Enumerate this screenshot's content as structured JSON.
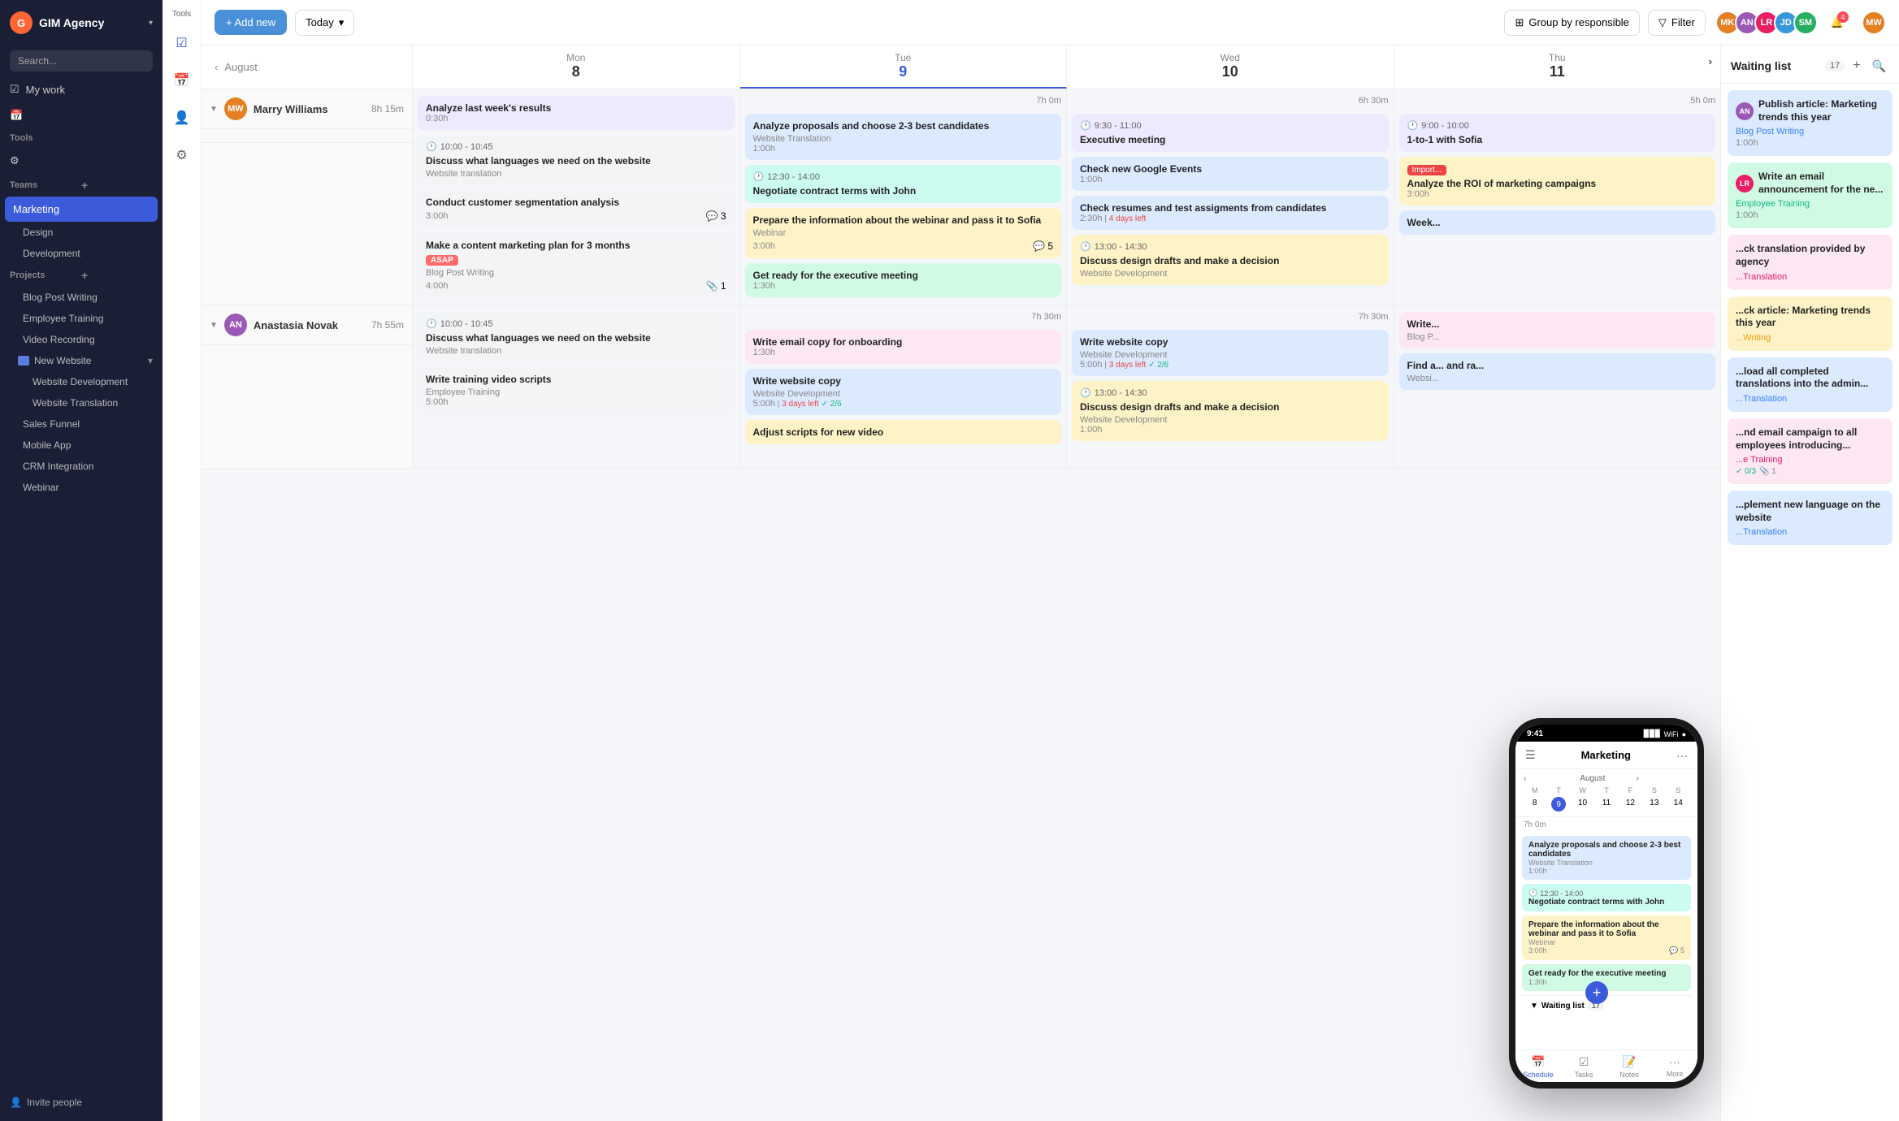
{
  "app": {
    "logo_label": "G",
    "company_name": "GIM Agency",
    "chevron": "▾"
  },
  "sidebar": {
    "search_placeholder": "Search...",
    "nav_items": [
      {
        "id": "my-work",
        "label": "My work",
        "icon": "☑"
      },
      {
        "id": "calendar",
        "label": "",
        "icon": "📅"
      },
      {
        "id": "people",
        "label": "",
        "icon": "👤"
      },
      {
        "id": "settings",
        "label": "",
        "icon": "⚙"
      }
    ],
    "tools_label": "Tools",
    "teams_label": "Teams",
    "teams": [
      {
        "id": "marketing",
        "label": "Marketing",
        "active": true
      },
      {
        "id": "design",
        "label": "Design"
      },
      {
        "id": "development",
        "label": "Development"
      }
    ],
    "projects_label": "Projects",
    "projects": [
      {
        "id": "blog-post-writing",
        "label": "Blog Post Writing"
      },
      {
        "id": "employee-training",
        "label": "Employee Training"
      },
      {
        "id": "video-recording",
        "label": "Video Recording"
      },
      {
        "id": "new-website",
        "label": "New Website",
        "is_folder": true,
        "expanded": true
      },
      {
        "id": "website-development",
        "label": "Website Development",
        "sub": true
      },
      {
        "id": "website-translation",
        "label": "Website Translation",
        "sub": true
      },
      {
        "id": "sales-funnel",
        "label": "Sales Funnel"
      },
      {
        "id": "mobile-app",
        "label": "Mobile App"
      },
      {
        "id": "crm-integration",
        "label": "CRM Integration"
      },
      {
        "id": "webinar",
        "label": "Webinar"
      }
    ],
    "invite_label": "Invite people"
  },
  "header": {
    "add_new_label": "+ Add new",
    "today_label": "Today",
    "today_chevron": "▾",
    "group_label": "Group by responsible",
    "filter_label": "Filter",
    "notification_count": "4",
    "avatars": [
      {
        "color": "#e67e22",
        "initials": "MK"
      },
      {
        "color": "#9b59b6",
        "initials": "AN"
      },
      {
        "color": "#e91e63",
        "initials": "LR"
      },
      {
        "color": "#3498db",
        "initials": "JD"
      },
      {
        "color": "#27ae60",
        "initials": "SM"
      }
    ]
  },
  "calendar": {
    "month_label": "August",
    "nav_prev": "‹",
    "nav_next": "›",
    "days": [
      {
        "label": "8 Mon",
        "today": false,
        "hours": ""
      },
      {
        "label": "9 Tue",
        "today": true,
        "hours": ""
      },
      {
        "label": "10 Wed",
        "today": false,
        "hours": ""
      },
      {
        "label": "11 Thu",
        "today": false,
        "hours": ""
      }
    ]
  },
  "persons": [
    {
      "id": "marry",
      "name": "Marry Williams",
      "avatar_color": "#e67e22",
      "initials": "MW",
      "total_hours": "8h 15m",
      "day_hours": [
        "",
        "7h 0m",
        "6h 30m",
        "5h 0m"
      ],
      "days": [
        [
          {
            "title": "Analyze last week's results",
            "duration": "0:30h",
            "color": "purple"
          },
          {
            "time": "10:00 - 10:45",
            "title": "Discuss what languages we need on the website",
            "project": "Website translation",
            "color": "gray"
          },
          {
            "title": "Conduct customer segmentation analysis",
            "duration": "3:00h",
            "color": "gray",
            "comments": 3
          },
          {
            "title": "Make a content marketing plan for 3 months",
            "tag": "ASAP",
            "project": "Blog Post Writing",
            "duration": "4:00h",
            "color": "gray",
            "attach": 1
          }
        ],
        [
          {
            "title": "Analyze proposals and choose 2-3 best candidates",
            "project": "Website Translation",
            "duration": "1:00h",
            "color": "blue"
          },
          {
            "time": "12:30 - 14:00",
            "title": "Negotiate contract terms with John",
            "color": "teal"
          },
          {
            "title": "Prepare the information about the webinar and pass it to Sofia",
            "project": "Webinar",
            "duration": "3:00h",
            "color": "orange",
            "comments": 5
          },
          {
            "title": "Get ready for the executive meeting",
            "duration": "1:30h",
            "color": "green"
          }
        ],
        [
          {
            "time": "9:30 - 11:00",
            "title": "Executive meeting",
            "color": "purple"
          },
          {
            "title": "Check new Google Events",
            "duration": "1:00h",
            "color": "blue"
          },
          {
            "time": "13:00 - 14:30",
            "title": "Discuss design drafts and make a decision",
            "project": "Website Development",
            "color": "orange"
          },
          {
            "title": "Check resumes and test assigments from candidates",
            "duration": "2:30h",
            "days_left": "4 days left",
            "color": "blue"
          }
        ],
        [
          {
            "time": "9:00 - 10:00",
            "title": "1-to-1 with Sofia",
            "color": "purple"
          },
          {
            "title": "Analyze the ROI of marketing campaigns",
            "import": true,
            "duration": "3:00h",
            "color": "orange"
          },
          {
            "title": "Week...",
            "color": "blue"
          }
        ]
      ]
    },
    {
      "id": "anastasia",
      "name": "Anastasia Novak",
      "avatar_color": "#9b59b6",
      "initials": "AN",
      "total_hours": "7h 55m",
      "day_hours": [
        "",
        "7h 30m",
        "7h 30m",
        ""
      ],
      "days": [
        [
          {
            "time": "10:00 - 10:45",
            "title": "Discuss what languages we need on the website",
            "project": "Website translation",
            "color": "gray"
          },
          {
            "title": "Write training video scripts",
            "project": "Employee Training",
            "duration": "5:00h",
            "color": "gray"
          }
        ],
        [
          {
            "title": "Write email copy for onboarding",
            "duration": "1:30h",
            "color": "pink"
          },
          {
            "title": "Write website copy",
            "project": "Website Development",
            "duration": "5:00h",
            "days_left": "3 days left",
            "completed": "2/6",
            "color": "blue"
          },
          {
            "title": "Adjust scripts for new video",
            "color": "orange"
          }
        ],
        [
          {
            "title": "Write website copy",
            "project": "Website Development",
            "duration": "5:00h",
            "days_left": "3 days left",
            "completed": "2/6",
            "color": "blue"
          },
          {
            "time": "13:00 - 14:30",
            "title": "Discuss design drafts and make a decision",
            "project": "Website Development",
            "duration": "1:00h",
            "color": "orange"
          }
        ],
        [
          {
            "title": "Write...",
            "project": "Blog P...",
            "color": "pink"
          },
          {
            "title": "Find a... and ra...",
            "project": "Websi...",
            "color": "blue"
          }
        ]
      ]
    }
  ],
  "waiting_list": {
    "title": "Waiting list",
    "count": 17,
    "cards": [
      {
        "title": "Publish article: Marketing trends this year",
        "project": "Blog Post Writing",
        "duration": "1:00h",
        "color": "#dbeafe",
        "project_color": "#3b82f6"
      },
      {
        "title": "Write an email announcement for the ne...",
        "project": "Employee Training",
        "duration": "1:00h",
        "color": "#d1fae5",
        "project_color": "#10b981"
      },
      {
        "title": "...ck translation provided by agency",
        "project": "...Translation",
        "color": "#fce7f3",
        "project_color": "#e91e63"
      },
      {
        "title": "...ck article: Marketing trends this year",
        "project": "...Writing",
        "color": "#fef3c7",
        "project_color": "#f59e0b"
      },
      {
        "title": "...load all completed translations into the admin...",
        "project": "...Translation",
        "color": "#dbeafe",
        "project_color": "#3b82f6"
      },
      {
        "title": "...nd email campaign to all employees introducing...",
        "project": "...e Training",
        "completed": "0/3",
        "attach": 1,
        "color": "#fce7f3",
        "project_color": "#e91e63"
      },
      {
        "title": "...plement new language on the website",
        "project": "...Translation",
        "color": "#dbeafe",
        "project_color": "#3b82f6"
      }
    ]
  },
  "phone": {
    "status_time": "9:41",
    "status_icons": "▉▉▉ WiFi ●",
    "header_title": "Marketing",
    "cal_month": "August",
    "cal_days_of_week": [
      "M",
      "T",
      "W",
      "T",
      "F",
      "S",
      "S"
    ],
    "cal_dates": [
      "8",
      "9",
      "10",
      "11",
      "12",
      "13",
      "14"
    ],
    "hours_label": "7h 0m",
    "tasks": [
      {
        "title": "Analyze proposals and choose 2-3 best candidates",
        "project": "Website Translation",
        "duration": "1:00h",
        "color": "#dbeafe"
      },
      {
        "time": "12:30 - 14:00",
        "title": "Negotiate contract terms with John",
        "color": "#ccfbf1"
      },
      {
        "title": "Prepare the information about the webinar and pass it to Sofia",
        "project": "Webinar",
        "duration": "3:00h",
        "color": "#fef3c7",
        "comments": 5
      },
      {
        "title": "Get ready for the executive meeting",
        "duration": "1:30h",
        "color": "#d1fae5"
      }
    ],
    "waiting_label": "Waiting list",
    "waiting_count": 17,
    "nav": [
      {
        "label": "Schedule",
        "icon": "📅",
        "active": true
      },
      {
        "label": "Tasks",
        "icon": "☑"
      },
      {
        "label": "Notes",
        "icon": "📝"
      },
      {
        "label": "More",
        "icon": "···"
      }
    ]
  }
}
